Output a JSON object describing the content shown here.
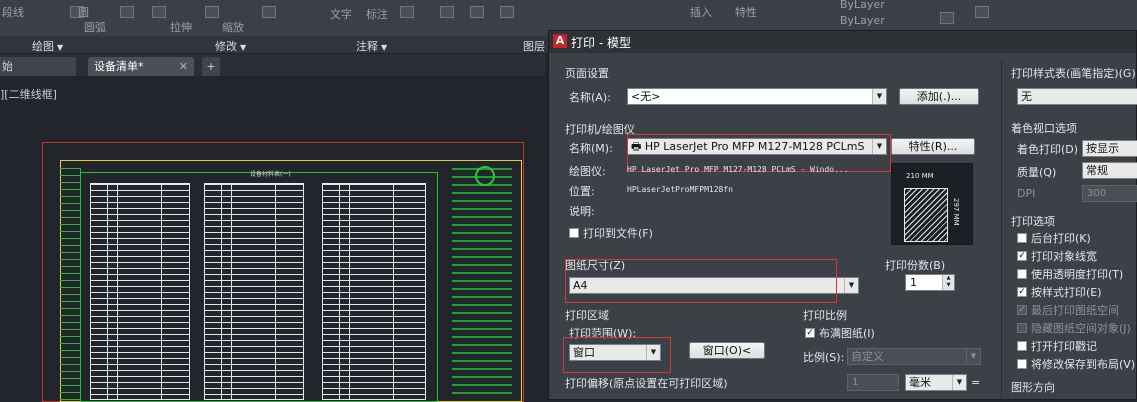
{
  "ribbon": {
    "items": [
      "段线",
      "圆",
      "圆弧",
      "拉伸",
      "缩放",
      "文字",
      "标注",
      "插入",
      "特性",
      "ByLayer",
      "ByLayer"
    ],
    "panels": [
      "绘图",
      "修改",
      "注释",
      "图层"
    ]
  },
  "doc_tabs": {
    "start_tab": "始",
    "active_tab": "设备清单*",
    "close_symbol": "✕",
    "plus_symbol": "+"
  },
  "viewport": {
    "label": "][二维线框]",
    "drawing_title": "设备材料表(一)"
  },
  "dialog": {
    "title": "打印 - 模型",
    "logo": "A",
    "page_setup": {
      "group_label": "页面设置",
      "name_label": "名称(A):",
      "name_value": "<无>",
      "add_button": "添加(.)..."
    },
    "printer": {
      "group_label": "打印机/绘图仪",
      "name_label": "名称(M):",
      "printer_value": "HP LaserJet Pro MFP M127-M128 PCLmS",
      "properties_button": "特性(R)...",
      "plotter_label": "绘图仪:",
      "plotter_value": "HP LaserJet Pro MFP M127-M128 PCLmS - Windo...",
      "location_label": "位置:",
      "location_value": "HPLaserJetProMFPM128fn",
      "description_label": "说明:",
      "print_to_file_label": "打印到文件(F)",
      "preview_width": "210 MM",
      "preview_height": "297 MM"
    },
    "paper_size": {
      "label": "图纸尺寸(Z)",
      "value": "A4"
    },
    "copies": {
      "label": "打印份数(B)",
      "value": "1"
    },
    "plot_area": {
      "group_label": "打印区域",
      "range_label": "打印范围(W):",
      "range_value": "窗口",
      "window_button": "窗口(O)<"
    },
    "plot_offset": {
      "label": "打印偏移(原点设置在可打印区域)"
    },
    "plot_scale": {
      "group_label": "打印比例",
      "fit_label": "布满图纸(I)",
      "scale_label": "比例(S):",
      "scale_value": "自定义",
      "value1": "1",
      "unit_value": "毫米",
      "equals": "="
    },
    "plot_style": {
      "group_label": "打印样式表(画笔指定)(G)",
      "value": "无"
    },
    "shaded_viewport": {
      "group_label": "着色视口选项",
      "shade_label": "着色打印(D)",
      "shade_value": "按显示",
      "quality_label": "质量(Q)",
      "quality_value": "常规",
      "dpi_label": "DPI",
      "dpi_value": "300"
    },
    "plot_options": {
      "group_label": "打印选项",
      "options": [
        {
          "label": "后台打印(K)",
          "checked": false,
          "disabled": false
        },
        {
          "label": "打印对象线宽",
          "checked": true,
          "disabled": false
        },
        {
          "label": "使用透明度打印(T)",
          "checked": false,
          "disabled": false
        },
        {
          "label": "按样式打印(E)",
          "checked": true,
          "disabled": false
        },
        {
          "label": "最后打印图纸空间",
          "checked": true,
          "disabled": true
        },
        {
          "label": "隐藏图纸空间对象(J)",
          "checked": false,
          "disabled": true
        },
        {
          "label": "打开打印戳记",
          "checked": false,
          "disabled": false
        },
        {
          "label": "将修改保存到布局(V)",
          "checked": false,
          "disabled": false
        }
      ]
    },
    "orientation": {
      "group_label": "图形方向"
    }
  }
}
